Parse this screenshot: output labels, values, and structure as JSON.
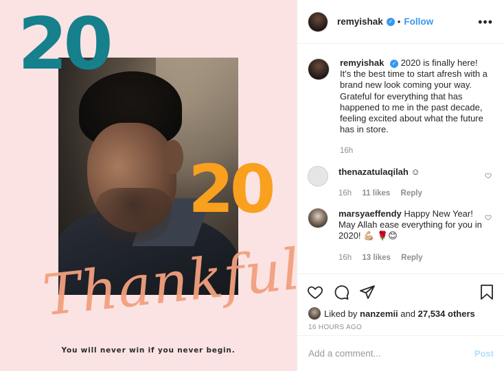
{
  "image": {
    "top_number": "20",
    "mid_number": "20",
    "script_word": "Thankful",
    "tagline": "You will never win if you never begin.",
    "colors": {
      "background": "#fbe3e3",
      "teal": "#16808c",
      "orange": "#f9a01e",
      "coral": "#f2a07e"
    }
  },
  "header": {
    "username": "remyishak",
    "verified_icon": "verified-badge-icon",
    "separator": "•",
    "follow_label": "Follow",
    "more_icon": "more-options-icon"
  },
  "caption": {
    "username": "remyishak",
    "text": "2020 is finally here! It's the best time to start afresh with a brand new look coming your way. Grateful for everything that has happened to me in the past decade, feeling excited about what the future has in store.",
    "time": "16h"
  },
  "comments": [
    {
      "username": "thenazatulaqilah",
      "text": "☺",
      "time": "16h",
      "likes": "11 likes",
      "reply": "Reply"
    },
    {
      "username": "marsyaeffendy",
      "text": "Happy New Year! May Allah ease everything for you in 2020! 💪🏼 🌹😊",
      "time": "16h",
      "likes": "13 likes",
      "reply": "Reply"
    }
  ],
  "actions": {
    "like_icon": "heart-icon",
    "comment_icon": "comment-icon",
    "share_icon": "share-icon",
    "save_icon": "bookmark-icon"
  },
  "likes": {
    "prefix": "Liked by",
    "user": "nanzemii",
    "and": "and",
    "others": "27,534 others"
  },
  "posted_time": "16 HOURS AGO",
  "add_comment": {
    "placeholder": "Add a comment...",
    "post_label": "Post"
  },
  "accent": "#3897f0"
}
